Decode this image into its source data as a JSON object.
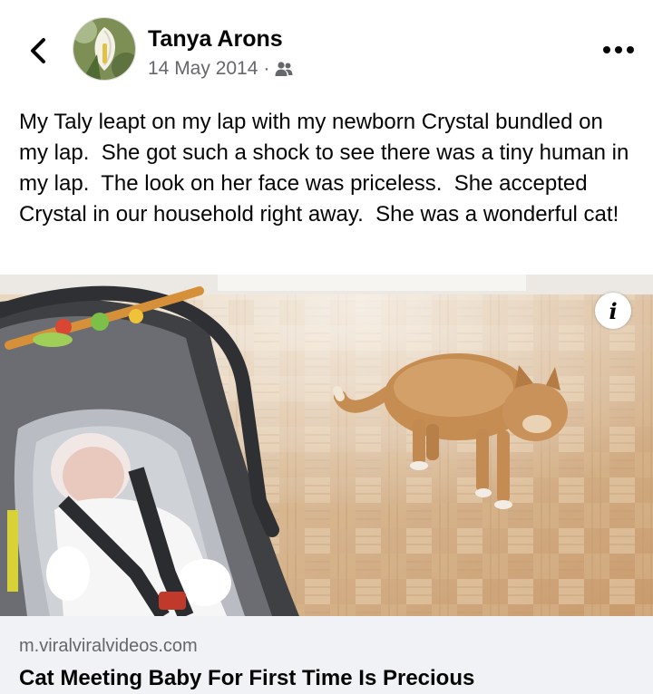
{
  "post": {
    "author": "Tanya Arons",
    "date": "14 May 2014",
    "separator": "·",
    "audience_icon": "friends-icon",
    "text": "My Taly leapt on my lap with my newborn Crystal bundled on my lap.  She got such a shock to see there was a tiny human in my lap.  The look on her face was priceless.  She accepted Crystal in our household right away.  She was a wonderful cat!"
  },
  "header": {
    "back_icon": "chevron-left-icon",
    "more_icon": "more-horizontal-icon"
  },
  "link_preview": {
    "domain": "m.viralviralvideos.com",
    "title": "Cat Meeting Baby For First Time Is Precious",
    "info_glyph": "i"
  },
  "colors": {
    "primary_text": "#050505",
    "secondary_text": "#65676b",
    "link_card_bg": "#f0f2f5"
  }
}
